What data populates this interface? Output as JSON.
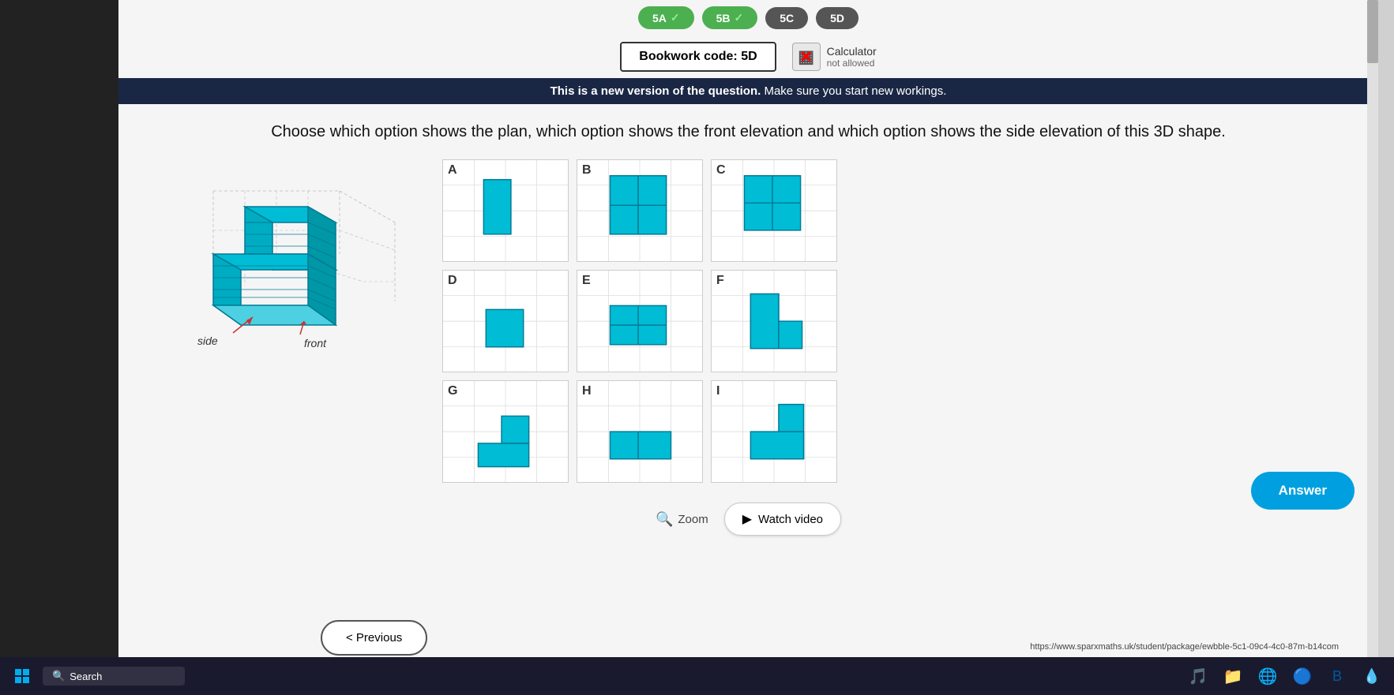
{
  "tabs": [
    {
      "label": "5A",
      "checked": true
    },
    {
      "label": "5B",
      "checked": true
    },
    {
      "label": "5C",
      "checked": false
    },
    {
      "label": "5D",
      "checked": false
    }
  ],
  "bookwork": {
    "label": "Bookwork code: 5D",
    "calculator_label": "Calculator",
    "calculator_status": "not allowed"
  },
  "banner": {
    "bold": "This is a new version of the question.",
    "normal": " Make sure you start new workings."
  },
  "question": "Choose which option shows the plan, which option shows the front elevation and which option shows the side elevation of this 3D shape.",
  "shape_labels": {
    "side": "side",
    "front": "front"
  },
  "options": [
    {
      "label": "A"
    },
    {
      "label": "B"
    },
    {
      "label": "C"
    },
    {
      "label": "D"
    },
    {
      "label": "E"
    },
    {
      "label": "F"
    },
    {
      "label": "G"
    },
    {
      "label": "H"
    },
    {
      "label": "I"
    }
  ],
  "buttons": {
    "zoom": "Zoom",
    "watch_video": "Watch video",
    "answer": "Answer",
    "previous": "< Previous"
  },
  "url": "https://www.sparxmaths.uk/student/package/ewbble-5c1-09c4-4c0-87m-b14com",
  "taskbar": {
    "search_placeholder": "Search"
  }
}
